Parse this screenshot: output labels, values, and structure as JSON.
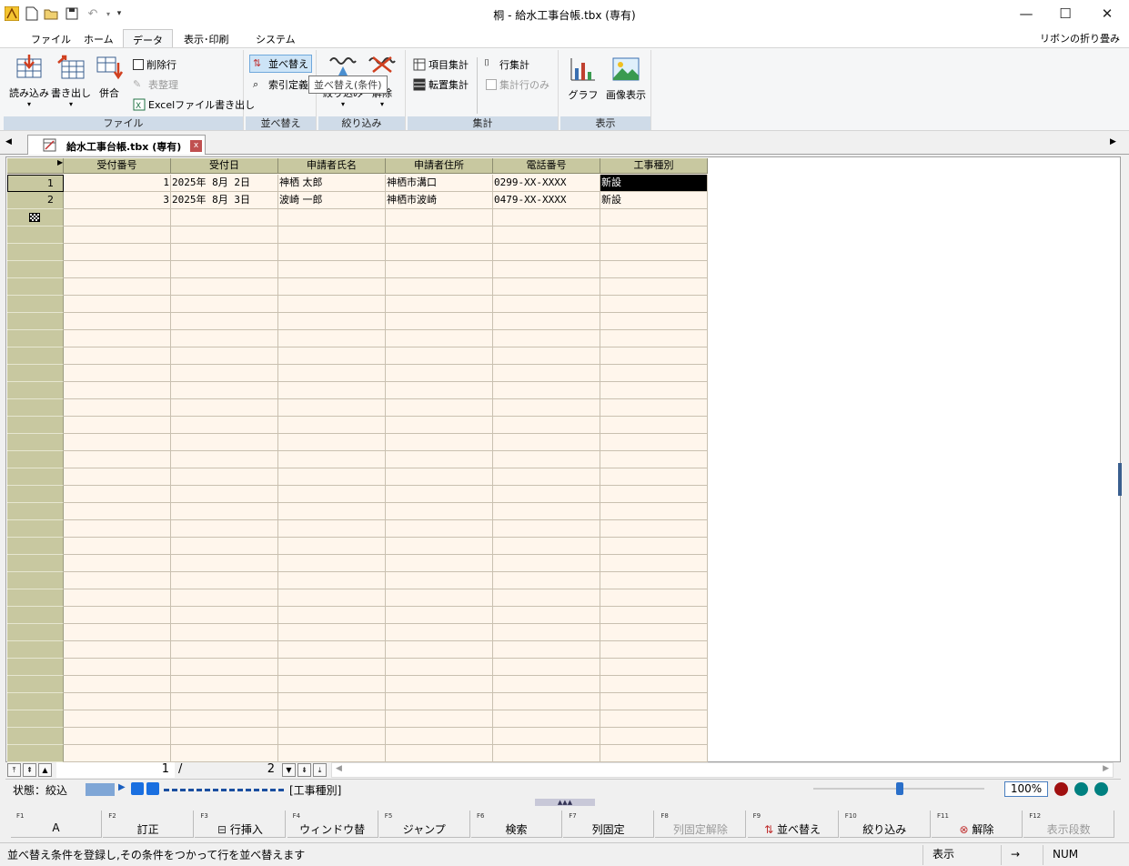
{
  "window": {
    "title": "桐 - 給水工事台帳.tbx (専有)",
    "minimize_icon": "minimize-icon",
    "maximize_icon": "maximize-icon",
    "close_icon": "close-icon"
  },
  "ribbon_tabs": [
    "ファイル",
    "ホーム",
    "データ",
    "表示･印刷",
    "システム"
  ],
  "active_tab": "データ",
  "ribbon_collapse": "リボンの折り畳み",
  "ribbon": {
    "file_group": {
      "label": "ファイル",
      "read": "読み込み",
      "write": "書き出し",
      "merge": "併合",
      "delete_row": "削除行",
      "table_cleanup": "表整理",
      "excel_write": "Excelファイル書き出し"
    },
    "sort_group": {
      "label": "並べ替え",
      "sort": "並べ替え",
      "index": "索引定義",
      "tooltip": "並べ替え(条件)"
    },
    "filter_group": {
      "label": "絞り込み",
      "filter": "絞り込み",
      "release": "解除"
    },
    "aggregate_group": {
      "label": "集計",
      "item_total": "項目集計",
      "cross_total": "転置集計",
      "row_total": "行集計",
      "total_rows_only": "集計行のみ"
    },
    "display_group": {
      "label": "表示",
      "graph": "グラフ",
      "image": "画像表示"
    }
  },
  "doc_tab": "給水工事台帳.tbx (専有)",
  "doc_tab_close": "x",
  "table": {
    "columns": [
      "受付番号",
      "受付日",
      "申請者氏名",
      "申請者住所",
      "電話番号",
      "工事種別"
    ],
    "rows": [
      {
        "row_no": "1",
        "cells": [
          "1",
          "2025年 8月 2日",
          "神栖 太郎",
          "神栖市溝口",
          "0299-XX-XXXX",
          "新設"
        ]
      },
      {
        "row_no": "2",
        "cells": [
          "3",
          "2025年 8月 3日",
          "波崎 一郎",
          "神栖市波崎",
          "0479-XX-XXXX",
          "新設"
        ]
      }
    ]
  },
  "navigation": {
    "current_page": "1",
    "separator": "/",
    "total_pages": "2"
  },
  "status": {
    "state": "状態：絞込",
    "field_name": "[工事種別]",
    "zoom": "100%"
  },
  "function_keys": [
    {
      "key": "F1",
      "label": "A",
      "enabled": true
    },
    {
      "key": "F2",
      "label": "訂正",
      "enabled": true
    },
    {
      "key": "F3",
      "label": "行挿入",
      "enabled": true
    },
    {
      "key": "F4",
      "label": "ウィンドウ替",
      "enabled": true
    },
    {
      "key": "F5",
      "label": "ジャンプ",
      "enabled": true
    },
    {
      "key": "F6",
      "label": "検索",
      "enabled": true
    },
    {
      "key": "F7",
      "label": "列固定",
      "enabled": true
    },
    {
      "key": "F8",
      "label": "列固定解除",
      "enabled": false
    },
    {
      "key": "F9",
      "label": "並べ替え",
      "enabled": true
    },
    {
      "key": "F10",
      "label": "絞り込み",
      "enabled": true
    },
    {
      "key": "F11",
      "label": "解除",
      "enabled": true
    },
    {
      "key": "F12",
      "label": "表示段数",
      "enabled": false
    }
  ],
  "bottom_status": {
    "message": "並べ替え条件を登録し,その条件をつかって行を並べ替えます",
    "mode": "表示",
    "arrow": "→",
    "numlock": "NUM"
  },
  "colors": {
    "header_bg": "#c8c8a0",
    "grid_bg": "#fff6ec",
    "group_label_bg": "#cfdbe8",
    "indicator_red": "#a01010",
    "indicator_teal": "#008080"
  }
}
